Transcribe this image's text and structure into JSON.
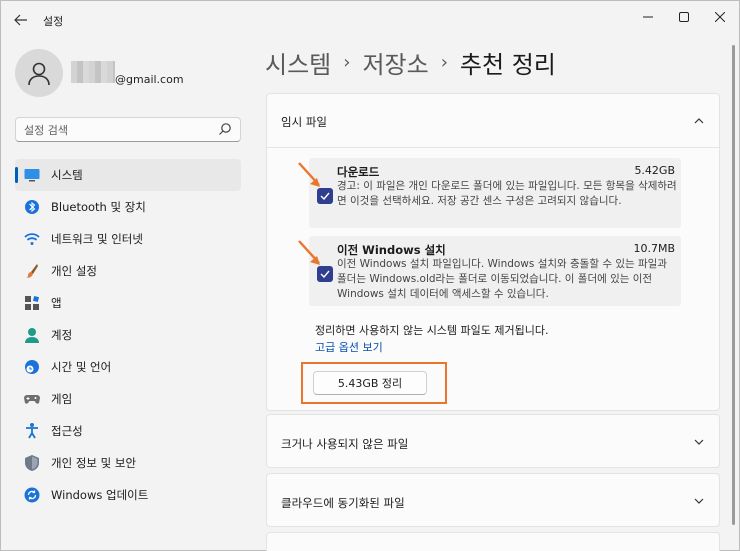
{
  "window": {
    "title": "설정"
  },
  "profile": {
    "email": "@gmail.com"
  },
  "search": {
    "placeholder": "설정 검색"
  },
  "sidebar": {
    "items": [
      {
        "label": "시스템",
        "icon": "system-icon",
        "selected": true
      },
      {
        "label": "Bluetooth 및 장치",
        "icon": "bluetooth-icon"
      },
      {
        "label": "네트워크 및 인터넷",
        "icon": "wifi-icon"
      },
      {
        "label": "개인 설정",
        "icon": "brush-icon"
      },
      {
        "label": "앱",
        "icon": "apps-icon"
      },
      {
        "label": "계정",
        "icon": "account-icon"
      },
      {
        "label": "시간 및 언어",
        "icon": "clock-globe-icon"
      },
      {
        "label": "게임",
        "icon": "gamepad-icon"
      },
      {
        "label": "접근성",
        "icon": "accessibility-icon"
      },
      {
        "label": "개인 정보 및 보안",
        "icon": "shield-icon"
      },
      {
        "label": "Windows 업데이트",
        "icon": "update-icon"
      }
    ]
  },
  "breadcrumb": {
    "part1": "시스템",
    "part2": "저장소",
    "part3": "추천 정리",
    "separator": "›"
  },
  "temp_files": {
    "title": "임시 파일",
    "items": [
      {
        "name": "다운로드",
        "size": "5.42GB",
        "checked": true,
        "description": "경고: 이 파일은 개인 다운로드 폴더에 있는 파일입니다. 모든 항목을 삭제하려면 이것을 선택하세요. 저장 공간 센스 구성은 고려되지 않습니다."
      },
      {
        "name": "이전 Windows 설치",
        "size": "10.7MB",
        "checked": true,
        "description": "이전 Windows 설치 파일입니다. Windows 설치와 충돌할 수 있는 파일과 폴더는 Windows.old라는 폴더로 이동되었습니다. 이 폴더에 있는 이전 Windows 설치 데이터에 액세스할 수 있습니다."
      }
    ],
    "note": "정리하면 사용하지 않는 시스템 파일도 제거됩니다.",
    "advanced_link": "고급 옵션 보기",
    "clean_button": "5.43GB 정리"
  },
  "sections": [
    {
      "title": "크거나 사용되지 않은 파일"
    },
    {
      "title": "클라우드에 동기화된 파일"
    }
  ],
  "colors": {
    "accent": "#005fb8",
    "checkbox": "#2f3e8f",
    "annotation": "#e9772b",
    "link": "#0a4fb0"
  }
}
